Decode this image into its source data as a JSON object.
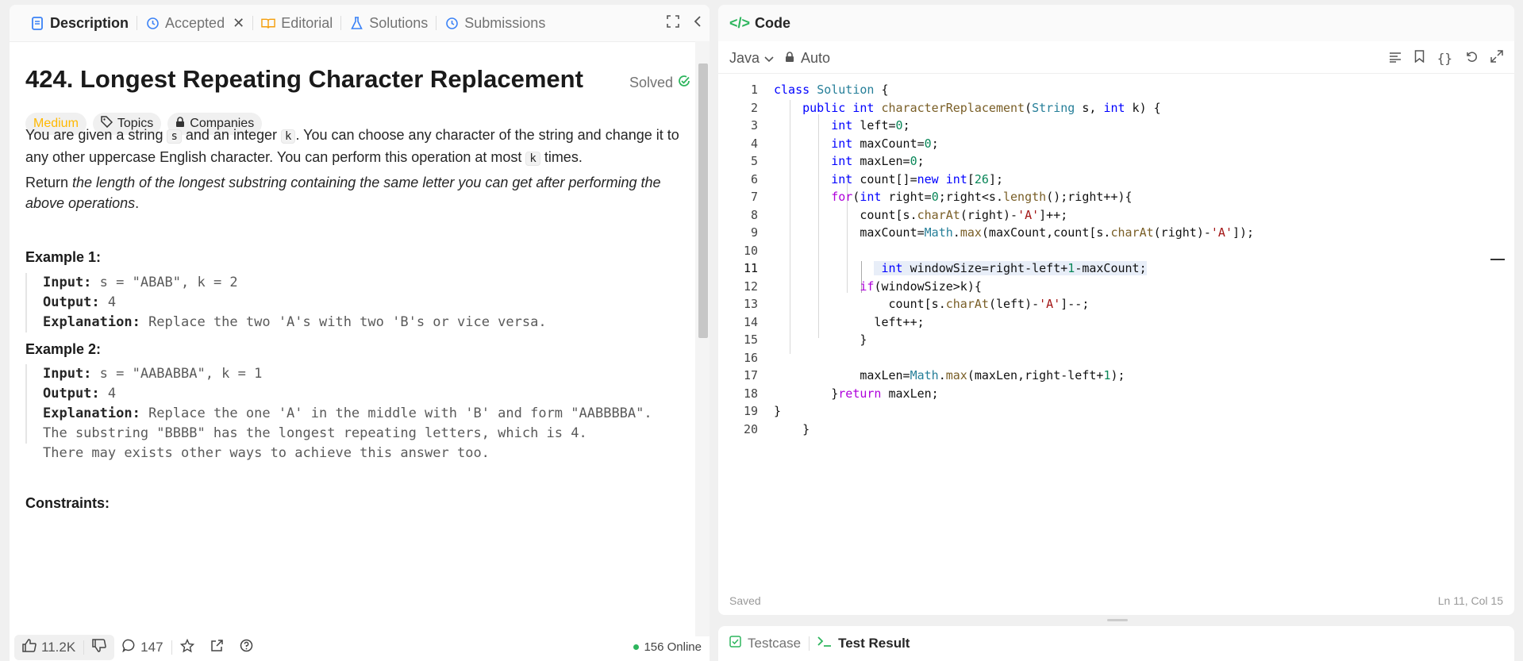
{
  "left_tabs": {
    "description": "Description",
    "accepted": "Accepted",
    "editorial": "Editorial",
    "solutions": "Solutions",
    "submissions": "Submissions"
  },
  "problem": {
    "title": "424. Longest Repeating Character Replacement",
    "status": "Solved",
    "difficulty": "Medium",
    "topics": "Topics",
    "companies": "Companies",
    "p1_a": "You are given a string ",
    "p1_code1": "s",
    "p1_b": " and an integer ",
    "p1_code2": "k",
    "p1_c": ". You can choose any character of the string and change it to any other uppercase English character. You can perform this operation at most ",
    "p1_code3": "k",
    "p1_d": " times.",
    "p2_a": "Return ",
    "p2_em": "the length of the longest substring containing the same letter you can get after performing the above operations",
    "p2_b": ".",
    "ex1_title": "Example 1:",
    "ex1_input_label": "Input:",
    "ex1_input": " s = \"ABAB\", k = 2",
    "ex1_output_label": "Output:",
    "ex1_output": " 4",
    "ex1_expl_label": "Explanation:",
    "ex1_expl": " Replace the two 'A's with two 'B's or vice versa.",
    "ex2_title": "Example 2:",
    "ex2_input_label": "Input:",
    "ex2_input": " s = \"AABABBA\", k = 1",
    "ex2_output_label": "Output:",
    "ex2_output": " 4",
    "ex2_expl_label": "Explanation:",
    "ex2_expl_1": " Replace the one 'A' in the middle with 'B' and form \"AABBBBA\".",
    "ex2_expl_2": "The substring \"BBBB\" has the longest repeating letters, which is 4.",
    "ex2_expl_3": "There may exists other ways to achieve this answer too.",
    "constraints": "Constraints:"
  },
  "footer": {
    "likes": "11.2K",
    "comments": "147",
    "online": "156 Online"
  },
  "code_panel": {
    "title": "Code",
    "language": "Java",
    "mode": "Auto",
    "status": "Saved",
    "cursor": "Ln 11, Col 15"
  },
  "code_lines": [
    "1",
    "2",
    "3",
    "4",
    "5",
    "6",
    "7",
    "8",
    "9",
    "10",
    "11",
    "12",
    "13",
    "14",
    "15",
    "16",
    "17",
    "18",
    "19",
    "20"
  ],
  "result_tabs": {
    "testcase": "Testcase",
    "test_result": "Test Result"
  },
  "colors": {
    "medium": "#ffb800",
    "accent_green": "#2db55d",
    "keyword": "#0000ff",
    "type": "#267f99",
    "string": "#a31515",
    "number": "#098658"
  }
}
